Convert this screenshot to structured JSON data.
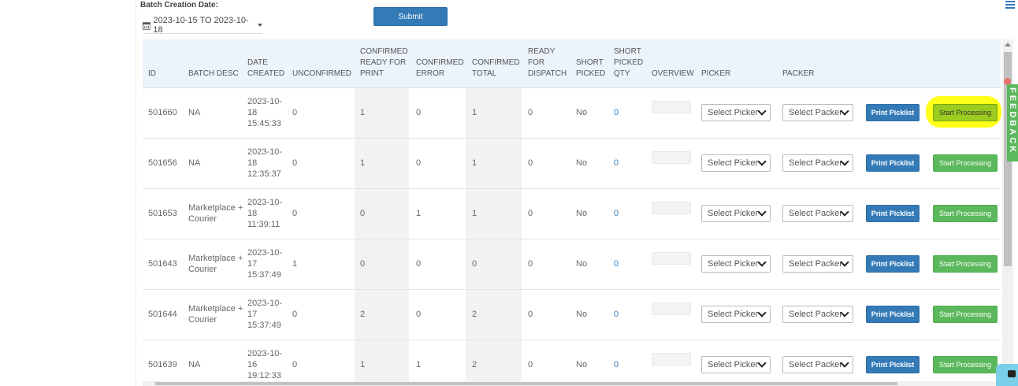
{
  "filter": {
    "label": "Batch Creation Date:",
    "date_range": "2023-10-15 TO 2023-10-18",
    "submit_label": "Submit"
  },
  "columns": [
    "ID",
    "BATCH DESC",
    "DATE CREATED",
    "UNCONFIRMED",
    "CONFIRMED READY FOR PRINT",
    "CONFIRMED ERROR",
    "CONFIRMED TOTAL",
    "READY FOR DISPATCH",
    "SHORT PICKED",
    "SHORT PICKED QTY",
    "OVERVIEW",
    "PICKER",
    "PACKER"
  ],
  "rows": [
    {
      "id": "501660",
      "desc": "NA",
      "date": "2023-10-18 15:45:33",
      "unconfirmed": "0",
      "ready_print": "1",
      "error": "0",
      "total": "1",
      "ready_dispatch": "0",
      "short_picked": "No",
      "short_qty": "0"
    },
    {
      "id": "501656",
      "desc": "NA",
      "date": "2023-10-18 12:35:37",
      "unconfirmed": "0",
      "ready_print": "1",
      "error": "0",
      "total": "1",
      "ready_dispatch": "0",
      "short_picked": "No",
      "short_qty": "0"
    },
    {
      "id": "501653",
      "desc": "Marketplace + Courier",
      "date": "2023-10-18 11:39:11",
      "unconfirmed": "0",
      "ready_print": "0",
      "error": "1",
      "total": "1",
      "ready_dispatch": "0",
      "short_picked": "No",
      "short_qty": "0"
    },
    {
      "id": "501643",
      "desc": "Marketplace + Courier",
      "date": "2023-10-17 15:37:49",
      "unconfirmed": "1",
      "ready_print": "0",
      "error": "0",
      "total": "0",
      "ready_dispatch": "0",
      "short_picked": "No",
      "short_qty": "0"
    },
    {
      "id": "501644",
      "desc": "Marketplace + Courier",
      "date": "2023-10-17 15:37:49",
      "unconfirmed": "0",
      "ready_print": "2",
      "error": "0",
      "total": "2",
      "ready_dispatch": "0",
      "short_picked": "No",
      "short_qty": "0"
    },
    {
      "id": "501639",
      "desc": "NA",
      "date": "2023-10-16 19:12:33",
      "unconfirmed": "0",
      "ready_print": "1",
      "error": "1",
      "total": "2",
      "ready_dispatch": "0",
      "short_picked": "No",
      "short_qty": "0"
    }
  ],
  "actions": {
    "picker_placeholder": "Select Picker",
    "packer_placeholder": "Select Packer",
    "print_label": "Print Picklist",
    "start_label": "Start Processing"
  },
  "feedback_label": "FEEDBACK",
  "colors": {
    "primary": "#337ab7",
    "success": "#5cb85c",
    "header_bg": "#ebf3fb",
    "highlight": "#ffff00"
  }
}
